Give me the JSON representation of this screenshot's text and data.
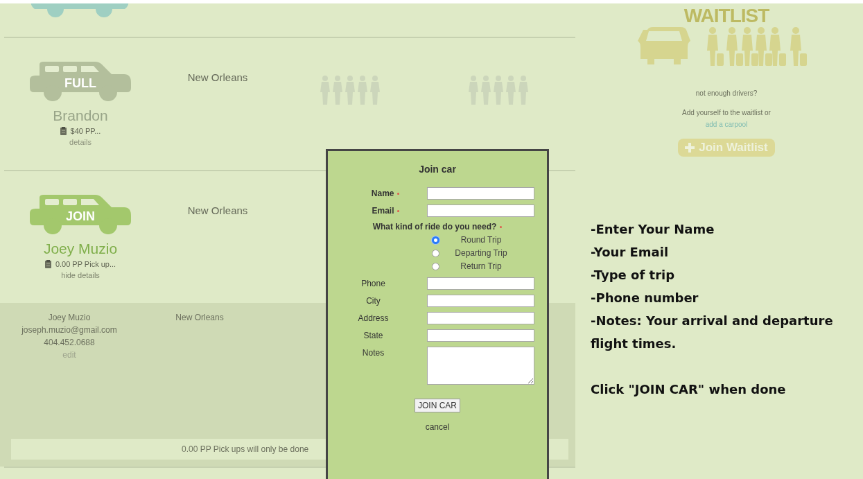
{
  "rides": [
    {
      "kind": "full",
      "car_label": "FULL",
      "driver": "Brandon",
      "price": "$40 PP...",
      "details_link": "details",
      "location": "New Orleans",
      "expanded": false
    },
    {
      "kind": "open",
      "car_label": "JOIN",
      "driver": "Joey Muzio",
      "price": "0.00 PP Pick up...",
      "details_link": "hide details",
      "location": "New Orleans",
      "expanded": true
    }
  ],
  "details": {
    "name": "Joey Muzio",
    "email": "joseph.muzio@gmail.com",
    "phone": "404.452.0688",
    "edit": "edit",
    "location": "New Orleans",
    "note": "0.00 PP Pick ups will only be done"
  },
  "waitlist": {
    "title": "WAITLIST",
    "question": "not enough drivers?",
    "text": "Add yourself to the waitlist or",
    "link": "add a carpool",
    "button": "Join Waitlist"
  },
  "modal": {
    "title": "Join car",
    "fields_top": [
      {
        "label": "Name",
        "required": true,
        "kind": "text"
      },
      {
        "label": "Email",
        "required": true,
        "kind": "text"
      }
    ],
    "question": {
      "label": "What kind of ride do you need?",
      "required": true
    },
    "options": [
      {
        "label": "Round Trip",
        "selected": true
      },
      {
        "label": "Departing Trip",
        "selected": false
      },
      {
        "label": "Return Trip",
        "selected": false
      }
    ],
    "fields_bottom": [
      {
        "label": "Phone",
        "required": false,
        "kind": "text"
      },
      {
        "label": "City",
        "required": false,
        "kind": "text"
      },
      {
        "label": "Address",
        "required": false,
        "kind": "text"
      },
      {
        "label": "State",
        "required": false,
        "kind": "text"
      },
      {
        "label": "Notes",
        "required": false,
        "kind": "textarea"
      }
    ],
    "submit": "JOIN CAR",
    "cancel": "cancel"
  },
  "instructions": [
    {
      "kind": "step",
      "text": "-Enter Your Name"
    },
    {
      "kind": "step",
      "text": "-Your Email"
    },
    {
      "kind": "step",
      "text": "-Type of trip"
    },
    {
      "kind": "step",
      "text": "-Phone number"
    },
    {
      "kind": "step",
      "text": "-Notes: Your arrival and departure flight times."
    },
    {
      "kind": "action",
      "text": "Click \"JOIN CAR\" when done"
    }
  ]
}
